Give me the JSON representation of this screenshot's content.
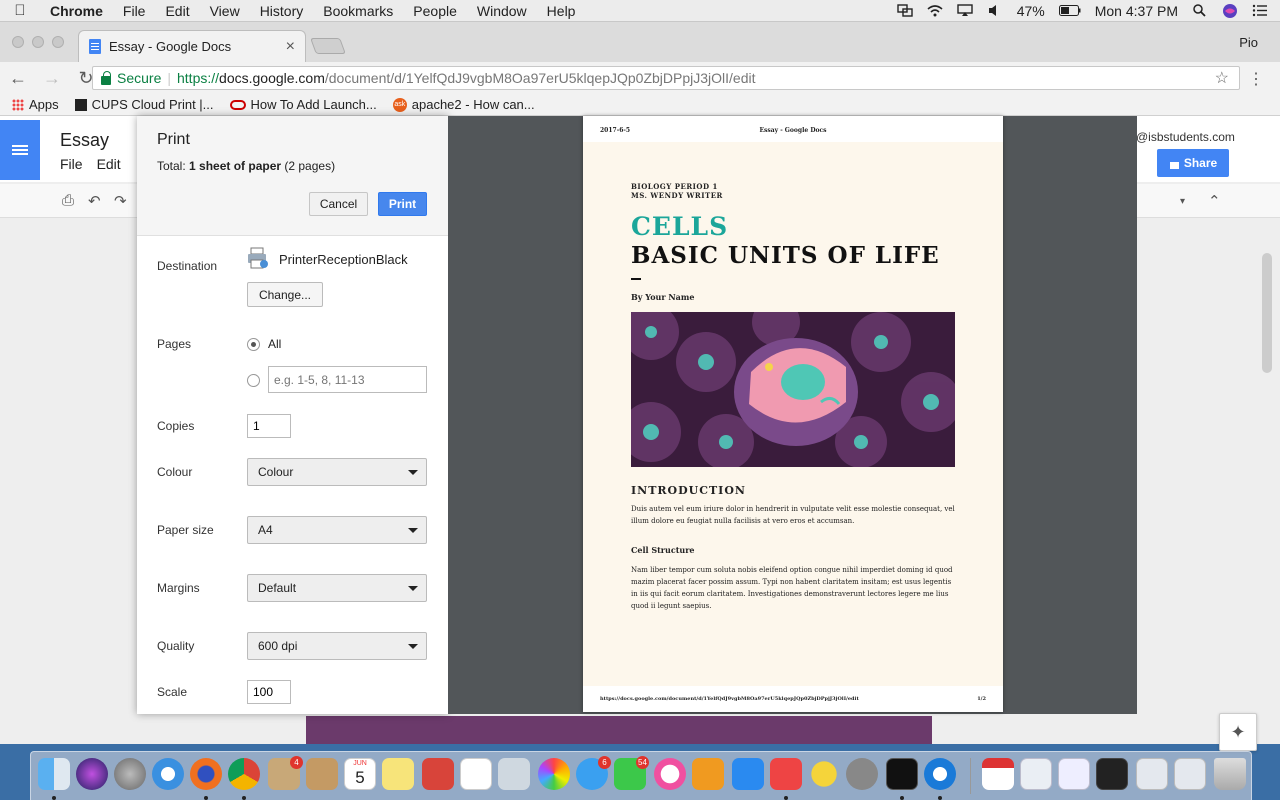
{
  "menubar": {
    "app": "Chrome",
    "items": [
      "File",
      "Edit",
      "View",
      "History",
      "Bookmarks",
      "People",
      "Window",
      "Help"
    ],
    "battery": "47%",
    "clock": "Mon 4:37 PM"
  },
  "browser": {
    "tab_title": "Essay - Google Docs",
    "profile": "Pio",
    "secure_label": "Secure",
    "url_scheme": "https://",
    "url_host": "docs.google.com",
    "url_path": "/document/d/1YelfQdJ9vgbM8Oa97erU5klqepJQp0ZbjDPpjJ3jOlI/edit",
    "bookmarks": [
      "Apps",
      "CUPS Cloud Print |...",
      "How To Add Launch...",
      "apache2 - How can..."
    ]
  },
  "docs": {
    "title": "Essay",
    "menu": [
      "File",
      "Edit"
    ],
    "account": "@isbstudents.com",
    "share_label": "Share"
  },
  "print": {
    "title": "Print",
    "total_prefix": "Total: ",
    "total_sheets": "1 sheet of paper",
    "total_pages": " (2 pages)",
    "cancel_label": "Cancel",
    "print_label": "Print",
    "destination_label": "Destination",
    "destination_value": "PrinterReceptionBlack",
    "change_label": "Change...",
    "pages_label": "Pages",
    "pages_all": "All",
    "pages_placeholder": "e.g. 1-5, 8, 11-13",
    "copies_label": "Copies",
    "copies_value": "1",
    "colour_label": "Colour",
    "colour_value": "Colour",
    "paper_label": "Paper size",
    "paper_value": "A4",
    "margins_label": "Margins",
    "margins_value": "Default",
    "quality_label": "Quality",
    "quality_value": "600 dpi",
    "scale_label": "Scale",
    "scale_value": "100"
  },
  "preview": {
    "header_date": "2017-6-5",
    "header_title": "Essay - Google Docs",
    "course_line1": "BIOLOGY PERIOD 1",
    "course_line2": "MS. WENDY WRITER",
    "heading": "CELLS",
    "subheading": "BASIC UNITS OF LIFE",
    "byline": "By Your Name",
    "intro_heading": "INTRODUCTION",
    "intro_text": "Duis autem vel eum iriure dolor in hendrerit in vulputate velit esse molestie consequat, vel illum dolore eu feugiat nulla facilisis at vero eros et accumsan.",
    "section_heading": "Cell Structure",
    "section_text": "Nam liber tempor cum soluta nobis eleifend option congue nihil imperdiet doming id quod mazim placerat facer possim assum. Typi non habent claritatem insitam; est usus legentis in iis qui facit eorum claritatem. Investigationes demonstraverunt lectores legere me lius quod ii legunt saepius.",
    "footer_url": "https://docs.google.com/document/d/1YelfQdJ9vgbM8Oa97erU5klqepJQp0ZbjDPpjJ3jOlI/edit",
    "footer_page": "1/2"
  },
  "dock": {
    "badges": {
      "mail": "4",
      "messages": "6",
      "facetime": "54"
    },
    "calendar_month": "JUN",
    "calendar_day": "5"
  },
  "colors": {
    "accent_blue": "#4285f4",
    "print_button": "#4787ed",
    "secure_green": "#0b8043",
    "title_teal": "#1ba69a",
    "preview_bg": "#525659"
  }
}
